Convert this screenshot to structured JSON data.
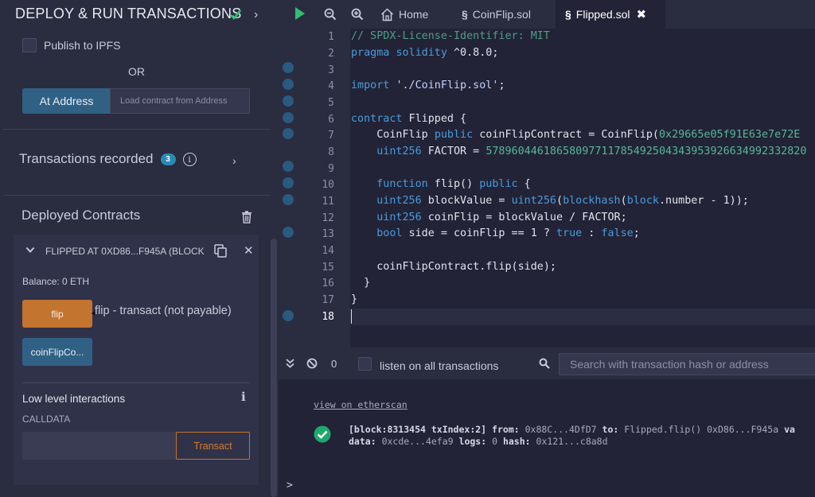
{
  "left_panel": {
    "title": "DEPLOY & RUN TRANSACTIONS",
    "publish_ipfs_label": "Publish to IPFS",
    "or_label": "OR",
    "at_address_button": "At Address",
    "at_address_placeholder": "Load contract from Address",
    "transactions_recorded_label": "Transactions recorded",
    "transactions_count": "3",
    "deployed_contracts_label": "Deployed Contracts",
    "instance": {
      "title": "FLIPPED AT 0XD86...F945A (BLOCK",
      "balance": "Balance: 0 ETH",
      "flip_button": "flip",
      "flip_tooltip": "flip - transact (not payable)",
      "coinflip_button": "coinFlipCo...",
      "low_level_label": "Low level interactions",
      "calldata_label": "CALLDATA",
      "transact_button": "Transact"
    }
  },
  "tabs": {
    "home": "Home",
    "coinflip": "CoinFlip.sol",
    "flipped": "Flipped.sol"
  },
  "editor": {
    "line_numbers": [
      "1",
      "2",
      "3",
      "4",
      "5",
      "6",
      "7",
      "8",
      "9",
      "10",
      "11",
      "12",
      "13",
      "14",
      "15",
      "16",
      "17",
      "18"
    ],
    "current_line": "18"
  },
  "terminal": {
    "counter": "0",
    "listen_label": "listen on all transactions",
    "search_placeholder": "Search with transaction hash or address",
    "etherscan_link": "view on etherscan",
    "tx_line1_block": "[block:8313454 txIndex:2]",
    "tx_from_label": "from:",
    "tx_from": "0x88C...4DfD7",
    "tx_to_label": "to:",
    "tx_to": "Flipped.flip() 0xD86...F945a",
    "tx_val": "va",
    "tx_data_label": "data:",
    "tx_data": "0xcde...4efa9",
    "tx_logs_label": "logs:",
    "tx_logs": "0",
    "tx_hash_label": "hash:",
    "tx_hash": "0x121...c8a8d",
    "prompt": ">"
  },
  "colors": {
    "accent_blue": "#306185",
    "accent_orange": "#c3742f",
    "success_green": "#1fa86e"
  }
}
